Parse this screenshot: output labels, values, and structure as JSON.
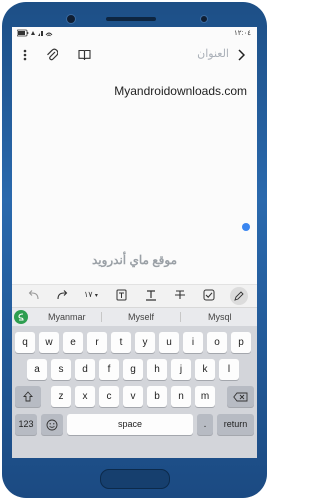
{
  "status_bar": {
    "time": "١٢:٠٤"
  },
  "toolbar": {
    "title_placeholder": "العنوان"
  },
  "editor": {
    "content": "Myandroidownloads.com"
  },
  "watermark": {
    "text": "موقع ماي أندرويد"
  },
  "format_bar": {
    "font_size": "١٧"
  },
  "suggestions": [
    "Myanmar",
    "Myself",
    "Mysql"
  ],
  "keyboard": {
    "row1": [
      "q",
      "w",
      "e",
      "r",
      "t",
      "y",
      "u",
      "i",
      "o",
      "p"
    ],
    "row2": [
      "a",
      "s",
      "d",
      "f",
      "g",
      "h",
      "j",
      "k",
      "l"
    ],
    "row3": [
      "z",
      "x",
      "c",
      "v",
      "b",
      "n",
      "m"
    ],
    "numbers_key": "123",
    "space_key": "space",
    "period_key": ".",
    "return_key": "return"
  },
  "colors": {
    "accent": "#3a86f0",
    "phone_body": "#2a69ad"
  }
}
